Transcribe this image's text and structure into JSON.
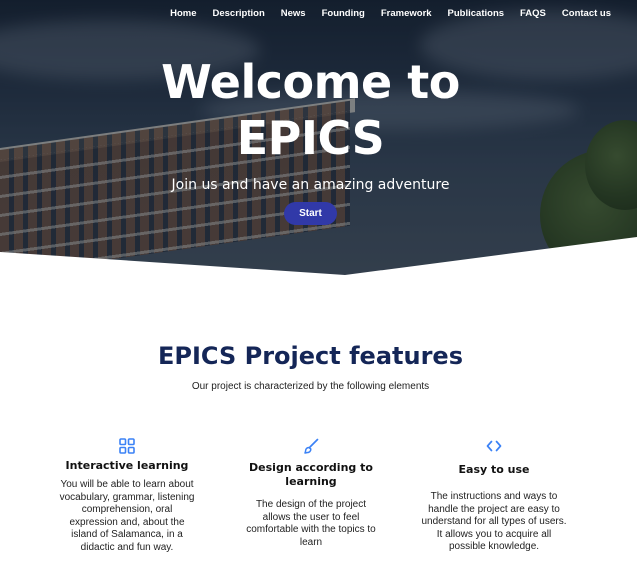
{
  "nav": {
    "items": [
      {
        "label": "Home"
      },
      {
        "label": "Description"
      },
      {
        "label": "News"
      },
      {
        "label": "Founding"
      },
      {
        "label": "Framework"
      },
      {
        "label": "Publications"
      },
      {
        "label": "FAQS"
      },
      {
        "label": "Contact us"
      }
    ]
  },
  "hero": {
    "title_line1": "Welcome to",
    "title_line2": "EPICS",
    "subtitle": "Join us and have an amazing adventure",
    "start_label": "Start"
  },
  "features": {
    "title": "EPICS Project features",
    "subtitle": "Our project is characterized by the following elements",
    "accent_color": "#3b82f6",
    "items": [
      {
        "icon": "grid-icon",
        "title": "Interactive learning",
        "text": "You will be able to learn about vocabulary, grammar, listening comprehension, oral expression and, about the island of Salamanca, in a didactic and fun way."
      },
      {
        "icon": "brush-icon",
        "title": "Design according to learning",
        "text": "The design of the project allows the user to feel comfortable with the topics to learn"
      },
      {
        "icon": "code-icon",
        "title": "Easy to use",
        "text": "The instructions and ways to handle the project are easy to understand for all types of users. It allows you to acquire all possible knowledge."
      }
    ]
  },
  "colors": {
    "primary_button": "#3139a8",
    "heading": "#142657"
  }
}
